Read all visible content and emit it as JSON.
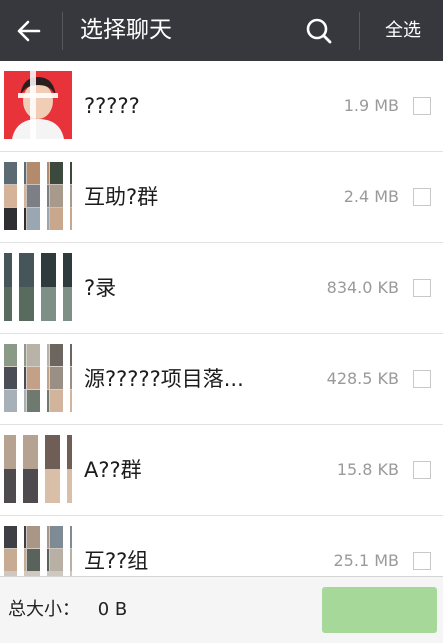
{
  "header": {
    "title": "选择聊天",
    "select_all_label": "全选",
    "icons": [
      "back-arrow-icon",
      "search-icon"
    ],
    "background_color": "#36383e"
  },
  "chats": [
    {
      "name": "?????",
      "size": "1.9 MB",
      "avatar": "portrait-avatar"
    },
    {
      "name": "互助?群",
      "size": "2.4 MB",
      "avatar": "group-avatar"
    },
    {
      "name": "?录",
      "size": "834.0 KB",
      "avatar": "group-avatar"
    },
    {
      "name": "源?????项目落...",
      "size": "428.5 KB",
      "avatar": "group-avatar"
    },
    {
      "name": "A??群",
      "size": "15.8 KB",
      "avatar": "group-avatar"
    },
    {
      "name": "互??组",
      "size": "25.1 MB",
      "avatar": "group-avatar"
    }
  ],
  "footer": {
    "total_label": "总大小：",
    "total_value": "0 B",
    "delete_button_color": "#a6d89a"
  }
}
